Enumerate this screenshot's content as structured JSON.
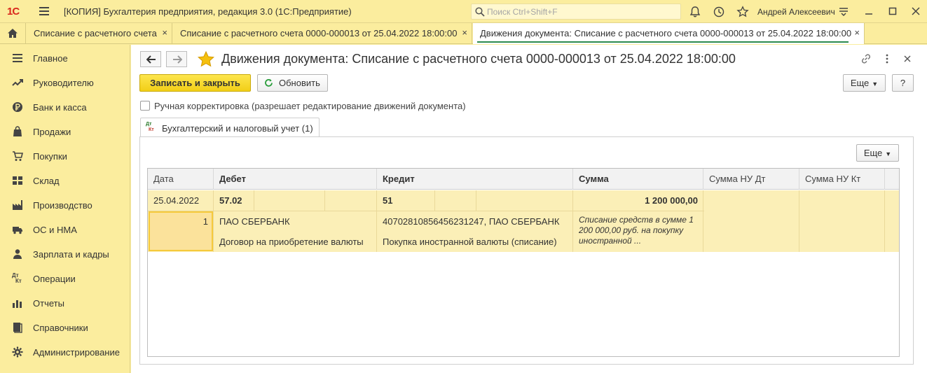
{
  "titlebar": {
    "logo": "1С",
    "title": "[КОПИЯ] Бухгалтерия предприятия, редакция 3.0  (1С:Предприятие)",
    "search_placeholder": "Поиск Ctrl+Shift+F",
    "user": "Андрей Алексеевич"
  },
  "tabs": [
    {
      "label": "Списание с расчетного счета"
    },
    {
      "label": "Списание с расчетного счета 0000-000013 от 25.04.2022 18:00:00"
    },
    {
      "label": "Движения документа: Списание с расчетного счета 0000-000013 от 25.04.2022 18:00:00"
    }
  ],
  "tab_close": "×",
  "sidebar": {
    "items": [
      {
        "label": "Главное",
        "icon": "menu-icon"
      },
      {
        "label": "Руководителю",
        "icon": "trend-icon"
      },
      {
        "label": "Банк и касса",
        "icon": "ruble-icon"
      },
      {
        "label": "Продажи",
        "icon": "bag-icon"
      },
      {
        "label": "Покупки",
        "icon": "cart-icon"
      },
      {
        "label": "Склад",
        "icon": "warehouse-icon"
      },
      {
        "label": "Производство",
        "icon": "factory-icon"
      },
      {
        "label": "ОС и НМА",
        "icon": "truck-icon"
      },
      {
        "label": "Зарплата и кадры",
        "icon": "person-icon"
      },
      {
        "label": "Операции",
        "icon": "dtkt-icon"
      },
      {
        "label": "Отчеты",
        "icon": "chart-icon"
      },
      {
        "label": "Справочники",
        "icon": "book-icon"
      },
      {
        "label": "Администрирование",
        "icon": "gear-icon"
      }
    ],
    "dtkt_top": "Дт",
    "dtkt_bottom": "Кт"
  },
  "document": {
    "title": "Движения документа: Списание с расчетного счета 0000-000013 от 25.04.2022 18:00:00",
    "save_close_label": "Записать и закрыть",
    "refresh_label": "Обновить",
    "more_label": "Еще",
    "help_label": "?",
    "close_label": "×",
    "manual_label": "Ручная корректировка (разрешает редактирование движений документа)",
    "subtab_label": "Бухгалтерский и налоговый учет (1)",
    "subtab_dt": "Дт",
    "subtab_kt": "Кт",
    "panel_more_label": "Еще"
  },
  "table": {
    "columns": [
      "Дата",
      "Дебет",
      "Кредит",
      "Сумма",
      "Сумма НУ Дт",
      "Сумма НУ Кт"
    ],
    "row": {
      "date": "25.04.2022",
      "num": "1",
      "debit_account": "57.02",
      "debit_sub1": "ПАО СБЕРБАНК",
      "debit_sub2": "Договор на приобретение валюты",
      "credit_account": "51",
      "credit_sub1": "40702810856456231247, ПАО СБЕРБАНК",
      "credit_sub2": "Покупка иностранной валюты (списание)",
      "amount": "1 200 000,00",
      "content": "Списание средств в сумме 1 200 000,00 руб. на покупку иностранной ..."
    }
  }
}
